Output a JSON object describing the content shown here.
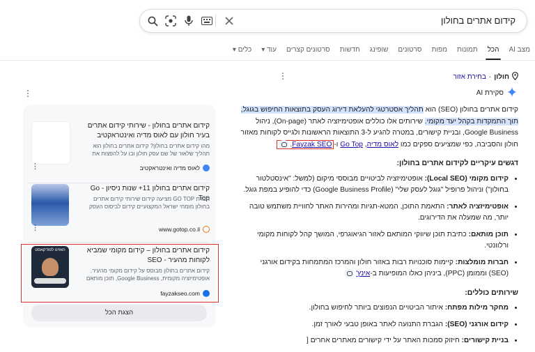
{
  "search": {
    "query": "קידום אתרים בחולון"
  },
  "tabs": [
    {
      "label": "מצב AI"
    },
    {
      "label": "הכל",
      "active": true
    },
    {
      "label": "תמונות"
    },
    {
      "label": "מפות"
    },
    {
      "label": "סרטונים"
    },
    {
      "label": "שופינג"
    },
    {
      "label": "חדשות"
    },
    {
      "label": "סרטונים קצרים"
    },
    {
      "label": "עוד ▾"
    },
    {
      "label": "כלים ▾"
    }
  ],
  "location": {
    "city": "חולון",
    "separator": " · ",
    "change": "בחירת אזור"
  },
  "ai_overview": {
    "label": "סקירת AI",
    "intro_pre": "קידום אתרים בחולון (SEO) הוא ",
    "intro_hl": "תהליך אסטרטגי להעלאת דירוג העסק בתוצאות החיפוש בגוגל, תוך התמקדות בקהל יעד מקומי.",
    "intro_post": " שירותים אלו כוללים אופטימיזציה לאתר (On-page), ניהול Google Business, ובניית קישורים, במטרה להגיע ל-3 התוצאות הראשונות ולגייס לקוחות מאזור חולון והסביבה, כפי שמציעים ספקים כמו ",
    "provider_1": "לאוס מדיה",
    "comma": ", ",
    "provider_2": "Go Top",
    "and": " ו-",
    "provider_3": "Fayzak SEO",
    "period": ".",
    "section1_title": "דגשים עיקריים לקידום אתרים בחולון:",
    "bullets1": [
      {
        "bold": "קידום מקומי (Local SEO):",
        "text": " אופטימיזציה לביטויים מבוססי מיקום (למשל: \"אינסטלטור בחולון\") וניהול פרופיל \"גוגל לעסק שלי\" (Google Business Profile) כדי להופיע במפת גוגל."
      },
      {
        "bold": "אופטימיזציה לאתר:",
        "text": " התאמת התוכן, המטא-תגיות ומהירות האתר לחוויית משתמש טובה יותר, מה שמעלה את הדירוגים."
      },
      {
        "bold": "תוכן מותאם:",
        "text": " כתיבת תוכן שיווקי המותאם לאזור הגיאוגרפי, המושך קהל לקוחות מקומי ורלוונטי."
      },
      {
        "bold": "חברות מומלצות:",
        "text": " קיימות סוכנויות רבות באזור חולון והמרכז המתמחות בקידום אורגני (SEO) וממומן (PPC), ביניהן כאלו המופיעות ב-",
        "link": "אינץ'"
      }
    ],
    "section2_title": "שירותים כוללים:",
    "bullets2": [
      {
        "bold": "מחקר מילות מפתח:",
        "text": " איתור הביטויים הנפוצים ביותר לחיפוש בחולון."
      },
      {
        "bold": "קידום אורגני (SEO):",
        "text": " הגברת התנועה לאתר באופן טבעי לאורך זמן."
      },
      {
        "bold": "בניית קישורים:",
        "text": " חיזוק סמכות האתר על ידי קישורים מאתרים אחרים ["
      }
    ]
  },
  "sources": [
    {
      "title": "קידום אתרים בחולון - שירותי קידום אתרים בעיר חולון עם לאוס מדיה ואינטראקטיב",
      "snippet": "מהו קידום אתרים בחולון? קידום אתרים בחולון הוא תהליך שלאור של שם עסק חולון ובו על להפצות את העסק בתוצאות החיפ...",
      "site": "לאוס מדיה ואינטראקטיב",
      "fav_color": "#4285f4"
    },
    {
      "title": "קידום אתרים בחולון 11+ שנות ניסיון - Go Top",
      "snippet": "חברת GO TOP מציעה קידום שירותי קידום אתרים בחולון מומחי ישראל המקצועיים קידום לביסוס העסק בגוגל בשיבוצים ...",
      "site": "www.gotop.co.il",
      "fav_color": "#e8710a"
    },
    {
      "title": "קידום אתרים בחולון – קידום מקומי שמביא לקוחות מהעיר - SEO",
      "snippet": "קידום אתרים בחולון מבוסס על קידום מקומי מהעיר. אופטימיזציה מקומית, Google Business, תוכן מותאם שכונות ודיוק נרא...",
      "site": "fayzakseo.com",
      "fav_color": "#1a73e8",
      "thumb_text": "האזינו לפודקאסט"
    }
  ],
  "show_all": "הצגת הכל"
}
